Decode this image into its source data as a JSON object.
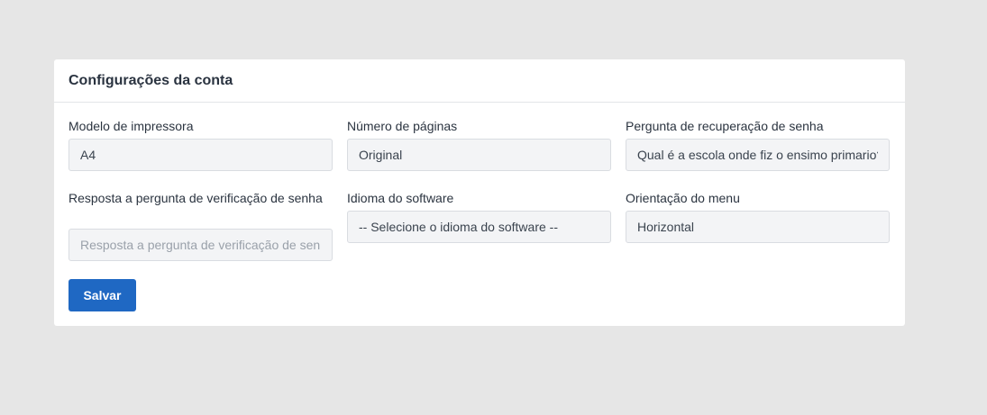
{
  "card": {
    "title": "Configurações da conta"
  },
  "form": {
    "printer_model": {
      "label": "Modelo de impressora",
      "value": "A4"
    },
    "page_count": {
      "label": "Número de páginas",
      "value": "Original"
    },
    "recovery_question": {
      "label": "Pergunta de recuperação de senha",
      "value": "Qual é a escola onde fiz o ensimo primario?"
    },
    "verification_answer": {
      "label": "Resposta a pergunta de verificação de senha",
      "value": "",
      "placeholder": "Resposta a pergunta de verificação de senha"
    },
    "software_language": {
      "label": "Idioma do software",
      "value": "-- Selecione o idioma do software --"
    },
    "menu_orientation": {
      "label": "Orientação do menu",
      "value": "Horizontal"
    }
  },
  "actions": {
    "save_label": "Salvar",
    "save_color": "#1f68c3"
  },
  "colors": {
    "background": "#e6e6e6",
    "card": "#ffffff",
    "input_background": "#f3f4f6"
  }
}
